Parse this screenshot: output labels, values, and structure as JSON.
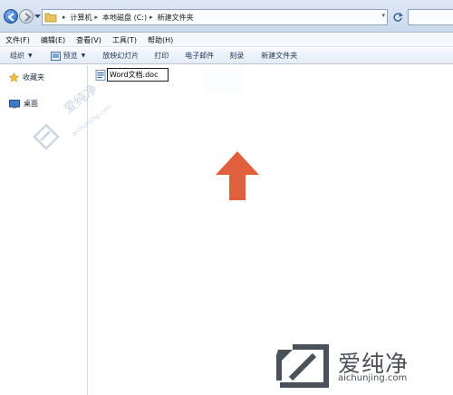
{
  "address": {
    "crumbs": [
      "计算机",
      "本地磁盘 (C:)",
      "新建文件夹"
    ]
  },
  "menu": {
    "items": [
      "文件(F)",
      "编辑(E)",
      "查看(V)",
      "工具(T)",
      "帮助(H)"
    ]
  },
  "toolbar": {
    "organize": "组织",
    "preview": "预览",
    "slideshow": "放映幻灯片",
    "print": "打印",
    "email": "电子邮件",
    "burn": "刻录",
    "new_folder": "新建文件夹"
  },
  "nav": {
    "favorites": "收藏夹",
    "desktop": "桌面"
  },
  "content": {
    "rename_value": "Word文档.doc"
  },
  "watermark": {
    "small_text": "爱纯净",
    "small_url": "aichunjing.com",
    "big_text": "爱纯净",
    "big_url": "aichunjing.com"
  },
  "colors": {
    "arrow": "#e0603d",
    "accent": "#1f5fb8"
  },
  "icons": {
    "back": "back-arrow-icon",
    "forward": "forward-arrow-icon",
    "folder": "folder-icon",
    "refresh": "refresh-icon",
    "favorites": "star-icon",
    "desktop": "desktop-icon",
    "file": "word-document-icon",
    "annotation": "up-arrow-icon"
  }
}
